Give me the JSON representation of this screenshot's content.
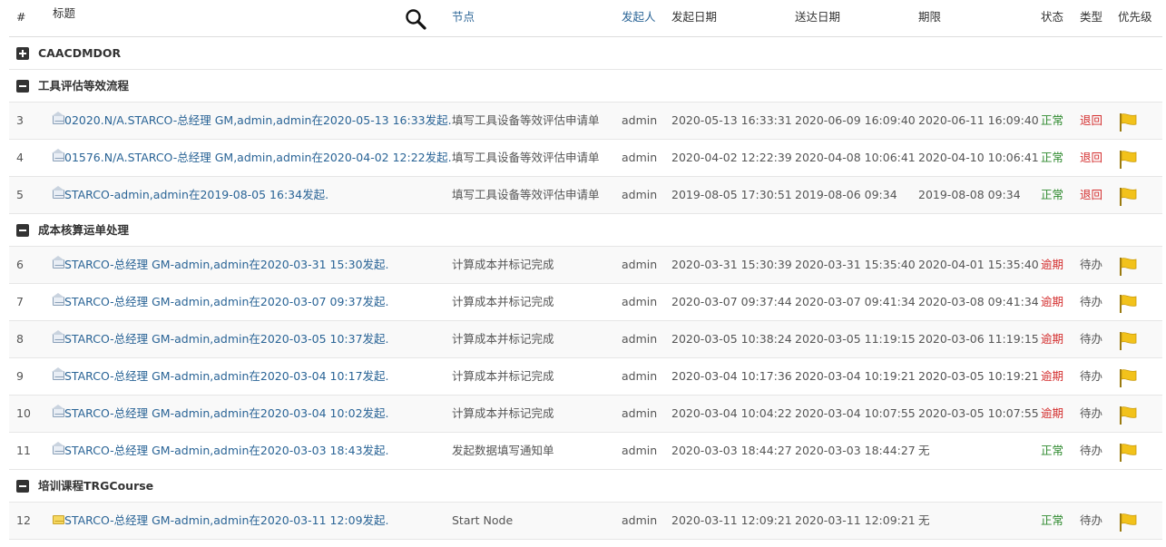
{
  "header": {
    "num": "#",
    "title": "标题",
    "node": "节点",
    "initiator": "发起人",
    "start_date": "发起日期",
    "send_date": "送达日期",
    "deadline": "期限",
    "status": "状态",
    "type": "类型",
    "priority": "优先级",
    "search_icon": "search-icon"
  },
  "groups": [
    {
      "name": "CAACDMDOR",
      "expanded": false,
      "rows": []
    },
    {
      "name": "工具评估等效流程",
      "expanded": true,
      "rows": [
        {
          "num": "3",
          "title": "02020.N/A.STARCO-总经理 GM,admin,admin在2020-05-13 16:33发起.",
          "node": "填写工具设备等效评估申请单",
          "initiator": "admin",
          "start": "2020-05-13 16:33:31",
          "send": "2020-06-09 16:09:40",
          "deadline": "2020-06-11 16:09:40",
          "status": "正常",
          "type": "退回",
          "mail": "open"
        },
        {
          "num": "4",
          "title": "01576.N/A.STARCO-总经理 GM,admin,admin在2020-04-02 12:22发起.",
          "node": "填写工具设备等效评估申请单",
          "initiator": "admin",
          "start": "2020-04-02 12:22:39",
          "send": "2020-04-08 10:06:41",
          "deadline": "2020-04-10 10:06:41",
          "status": "正常",
          "type": "退回",
          "mail": "open"
        },
        {
          "num": "5",
          "title": "STARCO-admin,admin在2019-08-05 16:34发起.",
          "node": "填写工具设备等效评估申请单",
          "initiator": "admin",
          "start": "2019-08-05 17:30:51",
          "send": "2019-08-06 09:34",
          "deadline": "2019-08-08 09:34",
          "status": "正常",
          "type": "退回",
          "mail": "open"
        }
      ]
    },
    {
      "name": "成本核算运单处理",
      "expanded": true,
      "rows": [
        {
          "num": "6",
          "title": "STARCO-总经理 GM-admin,admin在2020-03-31 15:30发起.",
          "node": "计算成本并标记完成",
          "initiator": "admin",
          "start": "2020-03-31 15:30:39",
          "send": "2020-03-31 15:35:40",
          "deadline": "2020-04-01 15:35:40",
          "status": "逾期",
          "type": "待办",
          "mail": "open"
        },
        {
          "num": "7",
          "title": "STARCO-总经理 GM-admin,admin在2020-03-07 09:37发起.",
          "node": "计算成本并标记完成",
          "initiator": "admin",
          "start": "2020-03-07 09:37:44",
          "send": "2020-03-07 09:41:34",
          "deadline": "2020-03-08 09:41:34",
          "status": "逾期",
          "type": "待办",
          "mail": "open"
        },
        {
          "num": "8",
          "title": "STARCO-总经理 GM-admin,admin在2020-03-05 10:37发起.",
          "node": "计算成本并标记完成",
          "initiator": "admin",
          "start": "2020-03-05 10:38:24",
          "send": "2020-03-05 11:19:15",
          "deadline": "2020-03-06 11:19:15",
          "status": "逾期",
          "type": "待办",
          "mail": "open"
        },
        {
          "num": "9",
          "title": "STARCO-总经理 GM-admin,admin在2020-03-04 10:17发起.",
          "node": "计算成本并标记完成",
          "initiator": "admin",
          "start": "2020-03-04 10:17:36",
          "send": "2020-03-04 10:19:21",
          "deadline": "2020-03-05 10:19:21",
          "status": "逾期",
          "type": "待办",
          "mail": "open"
        },
        {
          "num": "10",
          "title": "STARCO-总经理 GM-admin,admin在2020-03-04 10:02发起.",
          "node": "计算成本并标记完成",
          "initiator": "admin",
          "start": "2020-03-04 10:04:22",
          "send": "2020-03-04 10:07:55",
          "deadline": "2020-03-05 10:07:55",
          "status": "逾期",
          "type": "待办",
          "mail": "open"
        },
        {
          "num": "11",
          "title": "STARCO-总经理 GM-admin,admin在2020-03-03 18:43发起.",
          "node": "发起数据填写通知单",
          "initiator": "admin",
          "start": "2020-03-03 18:44:27",
          "send": "2020-03-03 18:44:27",
          "deadline": "无",
          "status": "正常",
          "type": "待办",
          "mail": "open"
        }
      ]
    },
    {
      "name": "培训课程TRGCourse",
      "expanded": true,
      "rows": [
        {
          "num": "12",
          "title": "STARCO-总经理 GM-admin,admin在2020-03-11 12:09发起.",
          "node": "Start Node",
          "initiator": "admin",
          "start": "2020-03-11 12:09:21",
          "send": "2020-03-11 12:09:21",
          "deadline": "无",
          "status": "正常",
          "type": "待办",
          "mail": "closed"
        }
      ]
    }
  ],
  "colors": {
    "link": "#2a6496",
    "ok": "#2f8a2f",
    "late": "#d43030",
    "flag": "#f2c21b"
  },
  "icons": {
    "flag": "flag-icon",
    "mail_open": "mail-open-icon",
    "mail_closed": "mail-icon",
    "expand": "plus-square-icon",
    "collapse": "minus-square-icon"
  }
}
